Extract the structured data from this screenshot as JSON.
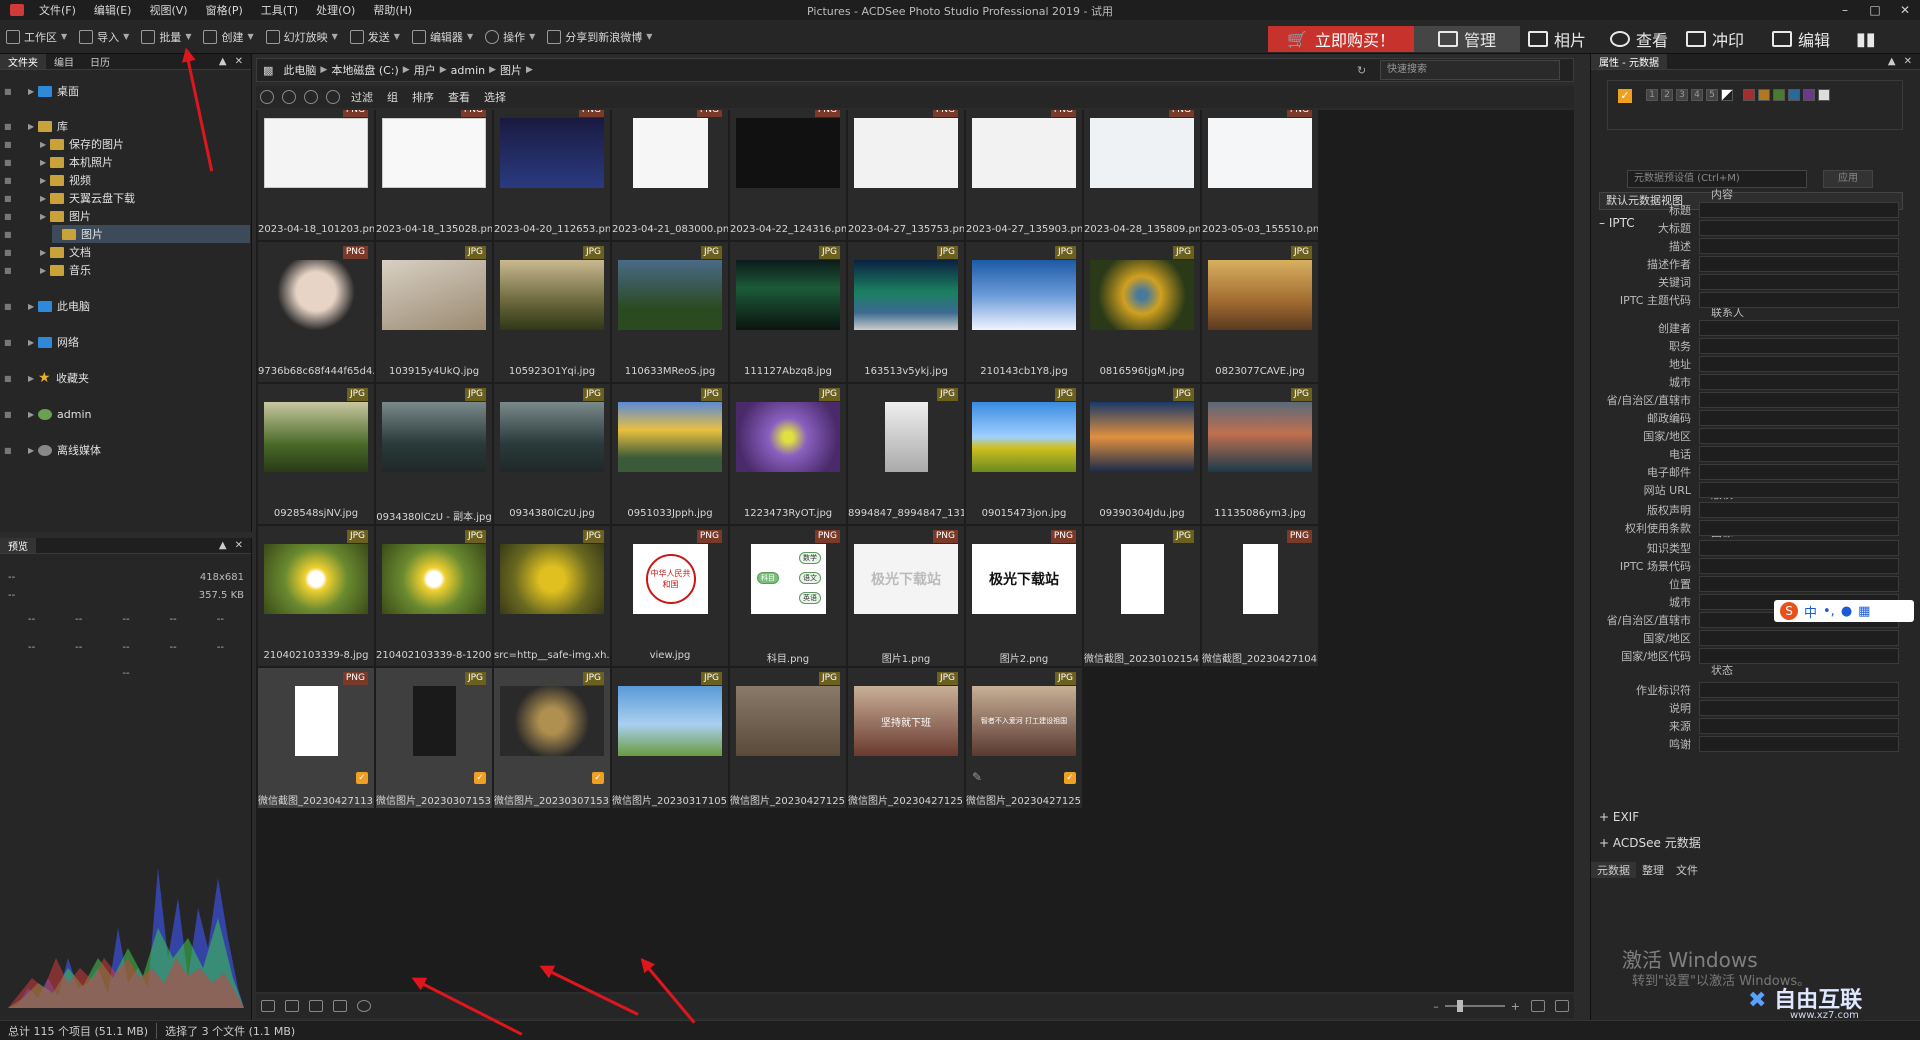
{
  "app": {
    "title": "Pictures - ACDSee Photo Studio Professional 2019 - 试用",
    "menus": [
      "文件(F)",
      "编辑(E)",
      "视图(V)",
      "窗格(P)",
      "工具(T)",
      "处理(O)",
      "帮助(H)"
    ]
  },
  "toolbar": {
    "items": [
      "工作区",
      "导入",
      "批量",
      "创建",
      "幻灯放映",
      "发送",
      "编辑器",
      "操作",
      "分享到新浪微博"
    ],
    "buy_label": "立即购买！",
    "modes": [
      "管理",
      "相片",
      "查看",
      "冲印",
      "编辑"
    ]
  },
  "folders_panel": {
    "tabs": [
      "文件夹",
      "编目",
      "日历"
    ],
    "tree": [
      {
        "label": "桌面",
        "level": 0,
        "icon": "blue-folder"
      },
      {
        "label": "库",
        "level": 0,
        "icon": "folder"
      },
      {
        "label": "保存的图片",
        "level": 1,
        "icon": "folder"
      },
      {
        "label": "本机照片",
        "level": 1,
        "icon": "folder"
      },
      {
        "label": "视频",
        "level": 1,
        "icon": "folder"
      },
      {
        "label": "天翼云盘下载",
        "level": 1,
        "icon": "folder"
      },
      {
        "label": "图片",
        "level": 1,
        "icon": "folder"
      },
      {
        "label": "图片",
        "level": 2,
        "icon": "folder",
        "selected": true
      },
      {
        "label": "文档",
        "level": 1,
        "icon": "folder"
      },
      {
        "label": "音乐",
        "level": 1,
        "icon": "folder"
      },
      {
        "label": "此电脑",
        "level": 0,
        "icon": "blue-folder"
      },
      {
        "label": "网络",
        "level": 0,
        "icon": "blue-folder"
      },
      {
        "label": "收藏夹",
        "level": 0,
        "icon": "star"
      },
      {
        "label": "admin",
        "level": 0,
        "icon": "user"
      },
      {
        "label": "离线媒体",
        "level": 0,
        "icon": "disc"
      }
    ]
  },
  "preview_panel": {
    "title": "预览",
    "dims": "418x681",
    "size": "357.5 KB",
    "dash": "--"
  },
  "address": {
    "crumbs": [
      "此电脑",
      "本地磁盘 (C:)",
      "用户",
      "admin",
      "图片"
    ],
    "search_placeholder": "快速搜索"
  },
  "filterbar": {
    "items": [
      "过滤",
      "组",
      "排序",
      "查看",
      "选择"
    ]
  },
  "files": [
    {
      "name": "2023-04-18_101203.png",
      "type": "PNG"
    },
    {
      "name": "2023-04-18_135028.png",
      "type": "PNG"
    },
    {
      "name": "2023-04-20_112653.png",
      "type": "PNG"
    },
    {
      "name": "2023-04-21_083000.png",
      "type": "PNG"
    },
    {
      "name": "2023-04-22_124316.png",
      "type": "PNG"
    },
    {
      "name": "2023-04-27_135753.png",
      "type": "PNG"
    },
    {
      "name": "2023-04-27_135903.png",
      "type": "PNG"
    },
    {
      "name": "2023-04-28_135809.png",
      "type": "PNG"
    },
    {
      "name": "2023-05-03_155510.png",
      "type": "PNG"
    },
    {
      "name": "9736b68c68f444f65d4...",
      "type": "PNG"
    },
    {
      "name": "103915y4UkQ.jpg",
      "type": "JPG"
    },
    {
      "name": "105923O1Yqi.jpg",
      "type": "JPG"
    },
    {
      "name": "110633MReoS.jpg",
      "type": "JPG"
    },
    {
      "name": "111127Abzq8.jpg",
      "type": "JPG"
    },
    {
      "name": "163513v5ykj.jpg",
      "type": "JPG"
    },
    {
      "name": "210143cb1Y8.jpg",
      "type": "JPG"
    },
    {
      "name": "0816596tjgM.jpg",
      "type": "JPG"
    },
    {
      "name": "0823077CAVE.jpg",
      "type": "JPG"
    },
    {
      "name": "0928548sjNV.jpg",
      "type": "JPG"
    },
    {
      "name": "0934380lCzU - 副本.jpg",
      "type": "JPG"
    },
    {
      "name": "0934380lCzU.jpg",
      "type": "JPG"
    },
    {
      "name": "0951033Jpph.jpg",
      "type": "JPG"
    },
    {
      "name": "1223473RyOT.jpg",
      "type": "JPG"
    },
    {
      "name": "8994847_8994847_131...",
      "type": "JPG"
    },
    {
      "name": "09015473jon.jpg",
      "type": "JPG"
    },
    {
      "name": "09390304Jdu.jpg",
      "type": "JPG"
    },
    {
      "name": "11135086ym3.jpg",
      "type": "JPG"
    },
    {
      "name": "210402103339-8.jpg",
      "type": "JPG"
    },
    {
      "name": "210402103339-8-1200...",
      "type": "JPG"
    },
    {
      "name": "src=http__safe-img.xh...",
      "type": "JPG"
    },
    {
      "name": "view.jpg",
      "type": "PNG"
    },
    {
      "name": "科目.png",
      "type": "PNG"
    },
    {
      "name": "图片1.png",
      "type": "PNG"
    },
    {
      "name": "图片2.png",
      "type": "PNG"
    },
    {
      "name": "微信截图_20230102154...",
      "type": "JPG"
    },
    {
      "name": "微信截图_20230427104...",
      "type": "PNG"
    },
    {
      "name": "微信截图_20230427113...",
      "type": "PNG",
      "checked": true,
      "selected": true
    },
    {
      "name": "微信图片_20230307153...",
      "type": "JPG",
      "checked": true,
      "selected": true
    },
    {
      "name": "微信图片_20230307153...",
      "type": "JPG",
      "checked": true,
      "selected": true
    },
    {
      "name": "微信图片_20230317105...",
      "type": "JPG"
    },
    {
      "name": "微信图片_20230427125...",
      "type": "JPG"
    },
    {
      "name": "微信图片_20230427125...",
      "type": "JPG"
    },
    {
      "name": "微信图片_20230427125...",
      "type": "JPG",
      "checked": true,
      "edited": true
    }
  ],
  "thumb_texts": {
    "view": "中华人民共和国",
    "subject_center": "科目",
    "subject_a": "数学",
    "subject_b": "语文",
    "subject_c": "英语",
    "pic1": "极光下载站",
    "pic2": "极光下载站",
    "wx1": "坚持就下班",
    "wx2": "智者不入爱河 打工建设祖国"
  },
  "status": {
    "total": "总计 115 个项目 (51.1 MB)",
    "selected": "选择了 3 个文件 (1.1 MB)"
  },
  "props": {
    "title": "属性 - 元数据",
    "preset_label": "元数据预设值 (Ctrl+M)",
    "apply_label": "应用",
    "view_label": "默认元数据视图",
    "iptc": "IPTC",
    "sections": {
      "content": "内容",
      "contact": "联系人",
      "rights": "版权",
      "image": "图像",
      "status": "状态"
    },
    "fields": [
      "标题",
      "大标题",
      "描述",
      "描述作者",
      "关键词",
      "IPTC 主题代码",
      "创建者",
      "职务",
      "地址",
      "城市",
      "省/自治区/直辖市",
      "邮政编码",
      "国家/地区",
      "电话",
      "电子邮件",
      "网站 URL",
      "版权声明",
      "权利使用条款",
      "知识类型",
      "IPTC 场景代码",
      "位置",
      "城市",
      "省/自治区/直辖市",
      "国家/地区",
      "国家/地区代码",
      "作业标识符",
      "说明",
      "来源",
      "鸣谢"
    ],
    "exif": "EXIF",
    "acdsee_meta": "ACDSee 元数据",
    "bottom_tabs": [
      "元数据",
      "整理",
      "文件"
    ],
    "rating_numbers": [
      "1",
      "2",
      "3",
      "4",
      "5"
    ],
    "label_colors": [
      "#a03030",
      "#b07820",
      "#4a7a30",
      "#2a6a9a",
      "#6a3a8a"
    ]
  },
  "ime": {
    "text": "中"
  },
  "watermark": {
    "line1": "激活 Windows",
    "line2": "转到\"设置\"以激活 Windows。",
    "logo": "自由互联",
    "logo_url": "www.xz7.com"
  }
}
